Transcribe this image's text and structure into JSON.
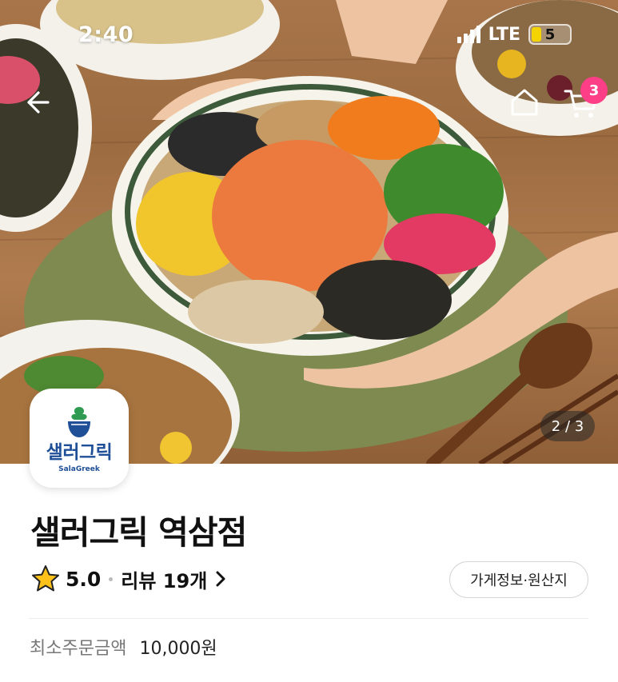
{
  "status_bar": {
    "time": "2:40",
    "network": "LTE",
    "battery": "5"
  },
  "header": {
    "back_icon": "arrow-left-icon",
    "home_icon": "home-icon",
    "cart_icon": "cart-icon",
    "cart_count": "3"
  },
  "hero": {
    "page_indicator": "2 / 3",
    "image_subject": "poke-bowl-photo"
  },
  "store": {
    "logo_text_kr": "샐러그릭",
    "logo_text_en": "SalaGreek",
    "name": "샐러그릭 역삼점",
    "rating": "5.0",
    "review_label": "리뷰 19개",
    "info_button": "가게정보·원산지",
    "min_order_label": "최소주문금액",
    "min_order_value": "10,000원"
  },
  "colors": {
    "brand_blue": "#1f4f96",
    "badge_pink": "#ff3e88",
    "star_yellow": "#ffc21a"
  }
}
